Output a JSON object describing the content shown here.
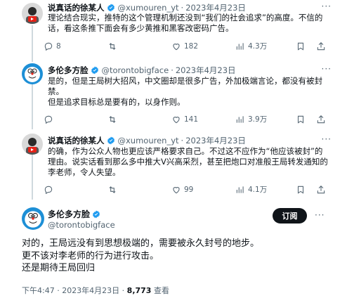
{
  "colors": {
    "accent": "#1d9bf0",
    "text": "#0f1419",
    "muted": "#536471",
    "verified": "#1d9bf0"
  },
  "tweets": [
    {
      "name": "说真话的徐某人",
      "handle": "@xumouren_yt",
      "separator": "·",
      "time": "2023年4月23日",
      "more_icon": "···",
      "text": [
        "理论结合现实，推特的这个管理机制还没到“我们的社会追求”的高度。不信的话，看这条推下面会有多少黄推和黑客改密码广告。"
      ],
      "replies": "8",
      "retweets": "",
      "likes": "182",
      "views": "4.3万"
    },
    {
      "name": "多伦多方脸",
      "handle": "@torontobigface",
      "separator": "·",
      "time": "2023年4月23日",
      "more_icon": "···",
      "text": [
        "是的，但是王局树大招风，中文圈却是很多广告，外加极端言论，都没有被封禁。",
        "但是追求目标总是要有的，以身作则。"
      ],
      "replies": "",
      "retweets": "",
      "likes": "141",
      "views": "3.9万"
    },
    {
      "name": "说真话的徐某人",
      "handle": "@xumouren_yt",
      "separator": "·",
      "time": "2023年4月23日",
      "more_icon": "···",
      "text": [
        "的确，作为公众人物也更应该严格要求自己。不过这不应作为“他应该被封”的理由。说实话看到那么多中推大V兴高采烈，甚至把炮口对准般王局转发通知的李老师，令人失望。"
      ],
      "replies": "",
      "retweets": "",
      "likes": "99",
      "views": "4.1万"
    }
  ],
  "main_tweet": {
    "name": "多伦多方脸",
    "handle": "@torontobigface",
    "follow_label": "订阅",
    "more_icon": "···",
    "text": [
      "对的，王局远没有到思想极端的，需要被永久封号的地步。",
      "更不该对李老师的行为进行攻击。",
      "还是期待王局回归"
    ],
    "time": "下午4:47 · 2023年4月23日 · ",
    "views_count": "8,773",
    "views_label": " 查看"
  },
  "icons": [
    "reply-icon",
    "retweet-icon",
    "like-icon",
    "views-icon",
    "bookmark-icon",
    "share-icon",
    "verified-icon",
    "more-icon"
  ]
}
